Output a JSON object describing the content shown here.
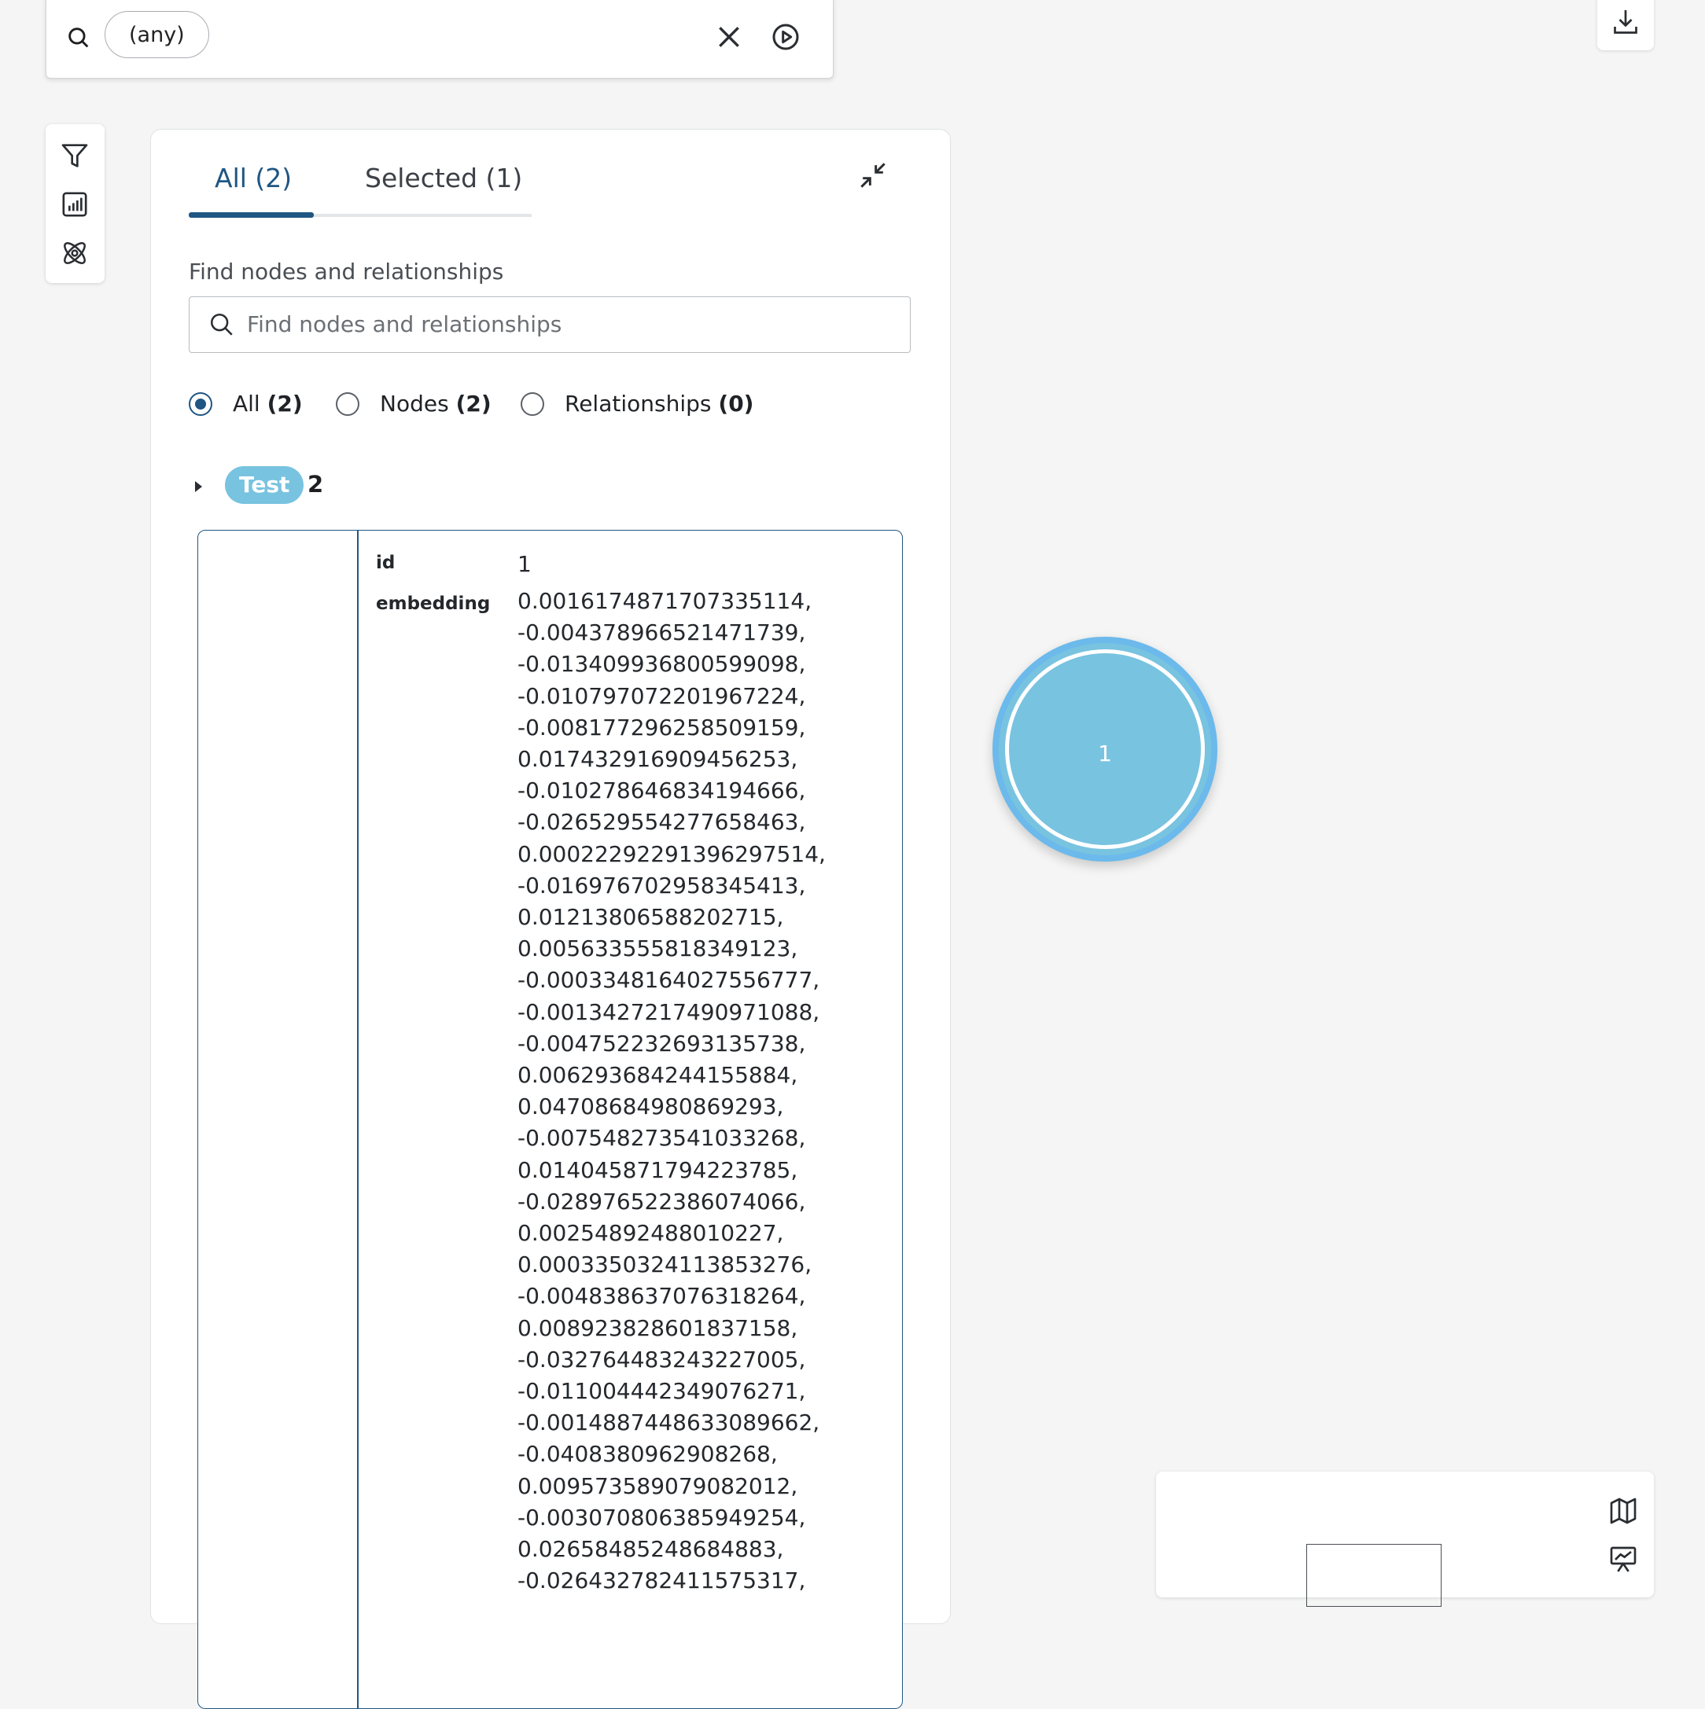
{
  "search": {
    "query_chip": "(any)"
  },
  "tabs": [
    {
      "label": "All (2)"
    },
    {
      "label": "Selected (1)"
    }
  ],
  "find": {
    "label": "Find nodes and relationships",
    "placeholder": "Find nodes and relationships"
  },
  "filter": {
    "all": {
      "label": "All",
      "count": "(2)"
    },
    "nodes": {
      "label": "Nodes",
      "count": "(2)"
    },
    "relationships": {
      "label": "Relationships",
      "count": "(0)"
    }
  },
  "group": {
    "label": "Test",
    "count": "2"
  },
  "detail": {
    "id_key": "id",
    "id_value": "1",
    "embedding_key": "embedding",
    "embedding": [
      "0.0016174871707335114,",
      "-0.004378966521471739,",
      "-0.013409936800599098,",
      "-0.010797072201967224,",
      "-0.008177296258509159,",
      "0.017432916909456253,",
      "-0.010278646834194666,",
      "-0.026529554277658463,",
      "0.00022292291396297514,",
      "-0.016976702958345413,",
      "0.01213806588202715,",
      "0.005633555818349123,",
      "-0.0003348164027556777,",
      "-0.0013427217490971088,",
      "-0.004752232693135738,",
      "0.006293684244155884,",
      "0.04708684980869293,",
      "-0.007548273541033268,",
      "0.014045871794223785,",
      "-0.028976522386074066,",
      "0.00254892488010227,",
      "0.0003350324113853276,",
      "-0.004838637076318264,",
      "0.008923828601837158,",
      "-0.032764483243227005,",
      "-0.011004442349076271,",
      "-0.0014887448633089662,",
      "-0.0408380962908268,",
      "0.009573589079082012,",
      "-0.003070806385949254,",
      "0.02658485248684883,",
      "-0.026432782411575317,"
    ]
  },
  "graph": {
    "node_caption": "1",
    "node_color": "#78c3e0",
    "node_border": "#6cb9ec"
  },
  "colors": {
    "accent": "#1f5683",
    "background": "#f4f5f4"
  }
}
